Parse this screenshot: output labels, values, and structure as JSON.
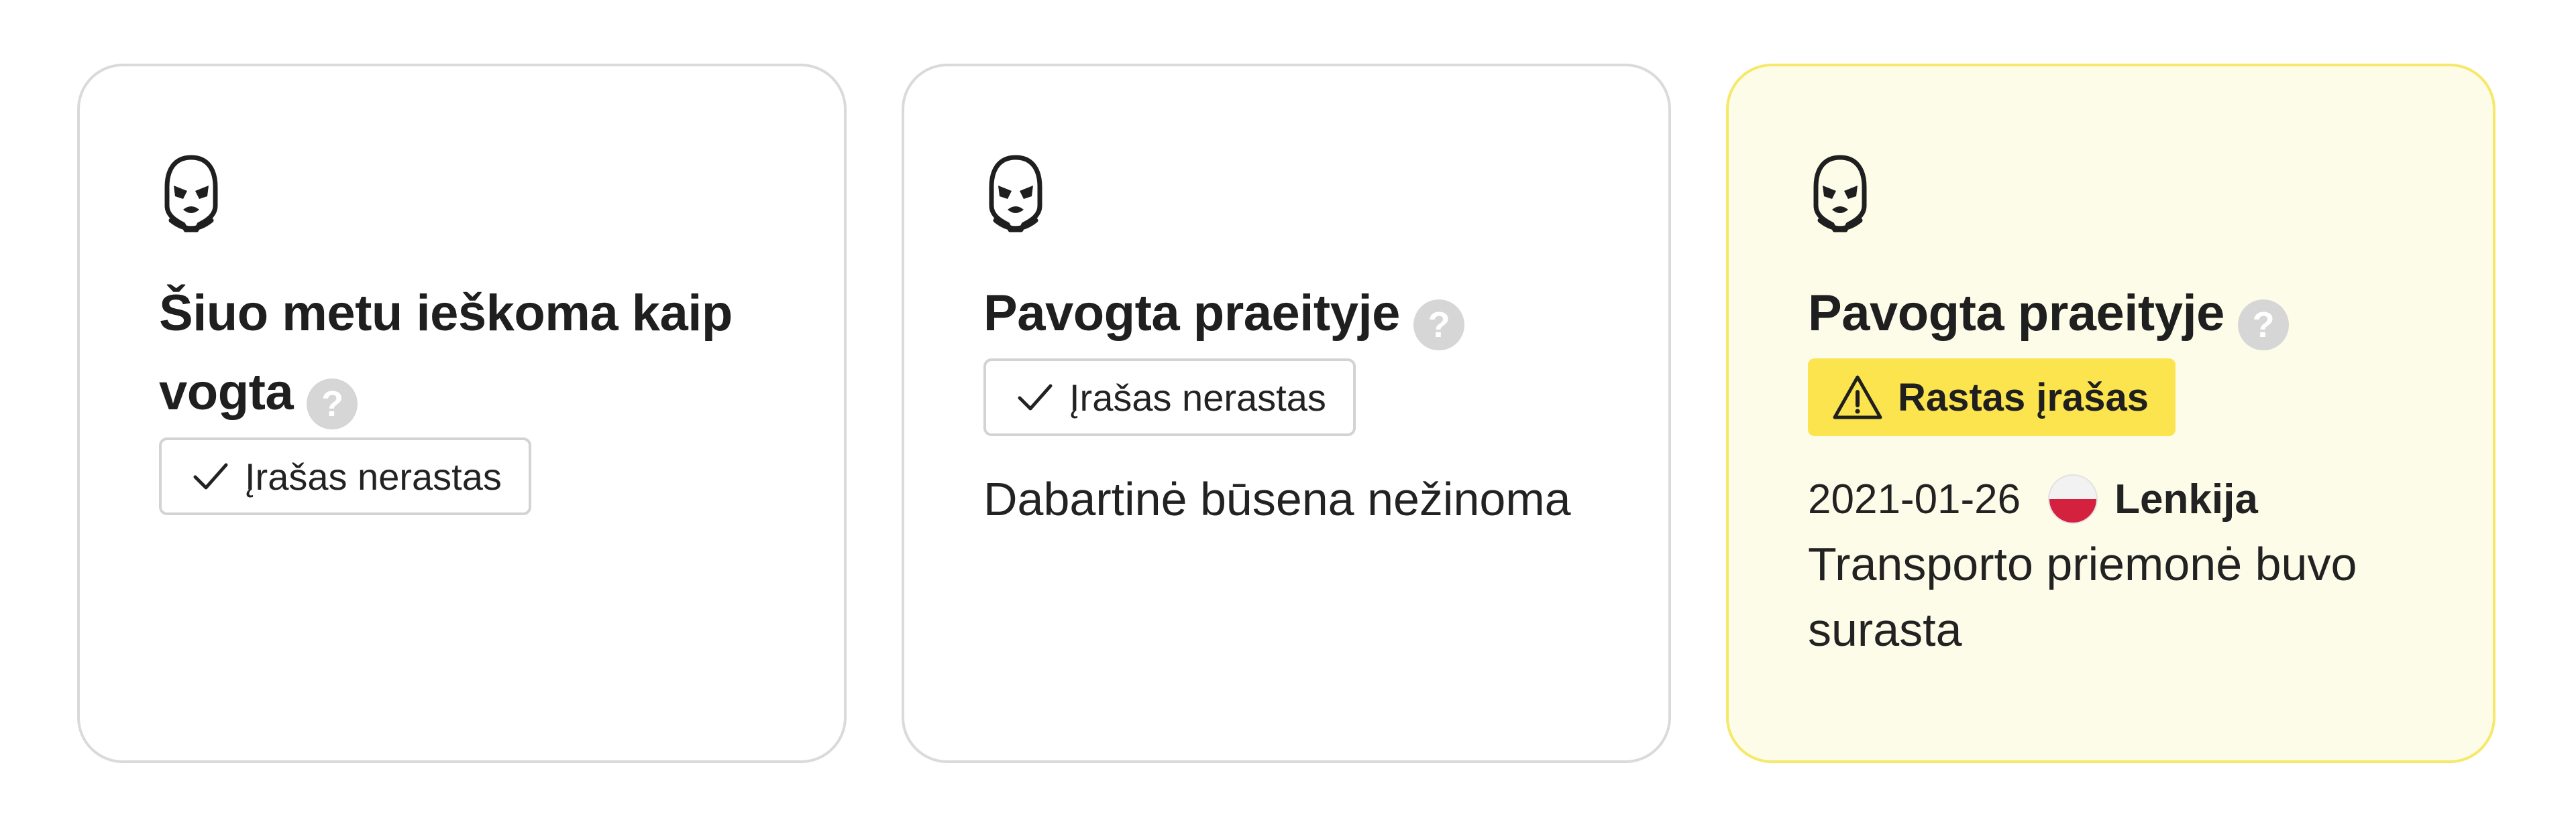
{
  "cards": [
    {
      "icon": "thief-mask-icon",
      "title": "Šiuo metu ieškoma kaip vogta",
      "help": "?",
      "badge": "Įrašas nerastas"
    },
    {
      "icon": "thief-mask-icon",
      "title": "Pavogta praeityje",
      "help": "?",
      "badge": "Įrašas nerastas",
      "note": "Dabartinė būsena nežinoma"
    },
    {
      "icon": "thief-mask-icon",
      "title": "Pavogta praeityje",
      "help": "?",
      "badge": "Rastas įrašas",
      "date": "2021-01-26",
      "country": "Lenkija",
      "note": "Transporto priemonė buvo surasta"
    }
  ],
  "colors": {
    "alert_background": "#fdfce8",
    "alert_border": "#f6e86a",
    "warning_badge": "#fbe44d",
    "card_border": "#dadada",
    "help_icon": "#d6d6d6"
  }
}
